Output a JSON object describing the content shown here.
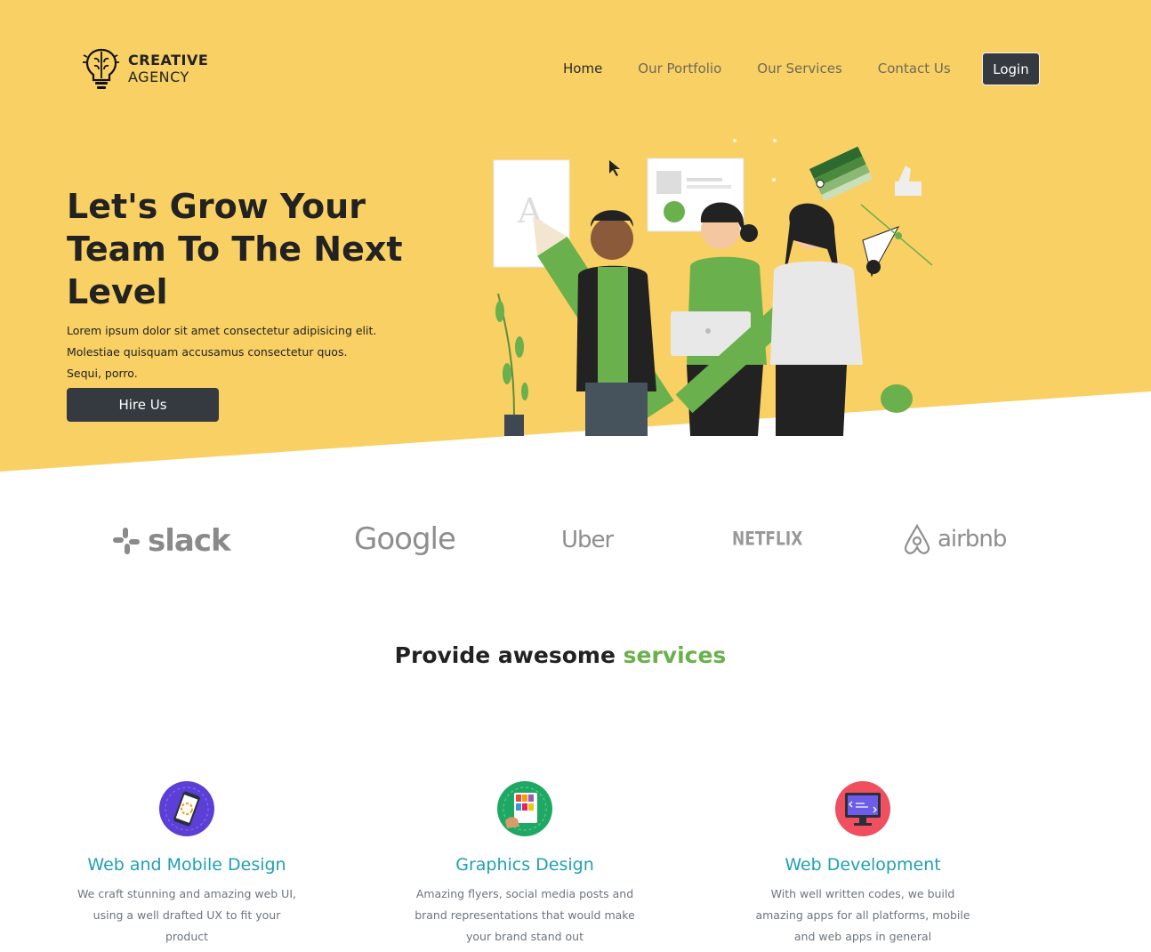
{
  "brand": {
    "line1": "CREATIVE",
    "line2": "AGENCY",
    "logo_icon": "brain-lightbulb-icon"
  },
  "nav": {
    "items": [
      {
        "label": "Home",
        "active": true
      },
      {
        "label": "Our Portfolio",
        "active": false
      },
      {
        "label": "Our Services",
        "active": false
      },
      {
        "label": "Contact Us",
        "active": false
      }
    ],
    "login_label": "Login"
  },
  "hero": {
    "title": "Let's Grow Your Team To The Next Level",
    "description": "Lorem ipsum dolor sit amet consectetur adipisicing elit. Molestiae quisquam accusamus consectetur quos. Sequi, porro.",
    "cta_label": "Hire Us",
    "illustration": "team-illustration",
    "background_color": "#f9d063"
  },
  "partners": [
    {
      "name": "slack",
      "icon": "slack-icon"
    },
    {
      "name": "Google"
    },
    {
      "name": "Uber"
    },
    {
      "name": "NETFLIX"
    },
    {
      "name": "airbnb",
      "icon": "airbnb-icon"
    }
  ],
  "services_section": {
    "title_main": "Provide awesome",
    "title_accent": "services",
    "accent_color": "#6ab04c"
  },
  "services": [
    {
      "title": "Web and Mobile Design",
      "description": "We craft stunning and amazing web UI, using a well drafted UX to fit your product",
      "icon": "mobile-design-icon"
    },
    {
      "title": "Graphics Design",
      "description": "Amazing flyers, social media posts and brand representations that would make your brand stand out",
      "icon": "color-palette-icon"
    },
    {
      "title": "Web Development",
      "description": "With well written codes, we build amazing apps for all platforms, mobile and web apps in general",
      "icon": "code-monitor-icon"
    }
  ],
  "colors": {
    "dark_button": "#343a40",
    "service_title": "#1fa0b4",
    "text_muted": "#6c757d"
  }
}
